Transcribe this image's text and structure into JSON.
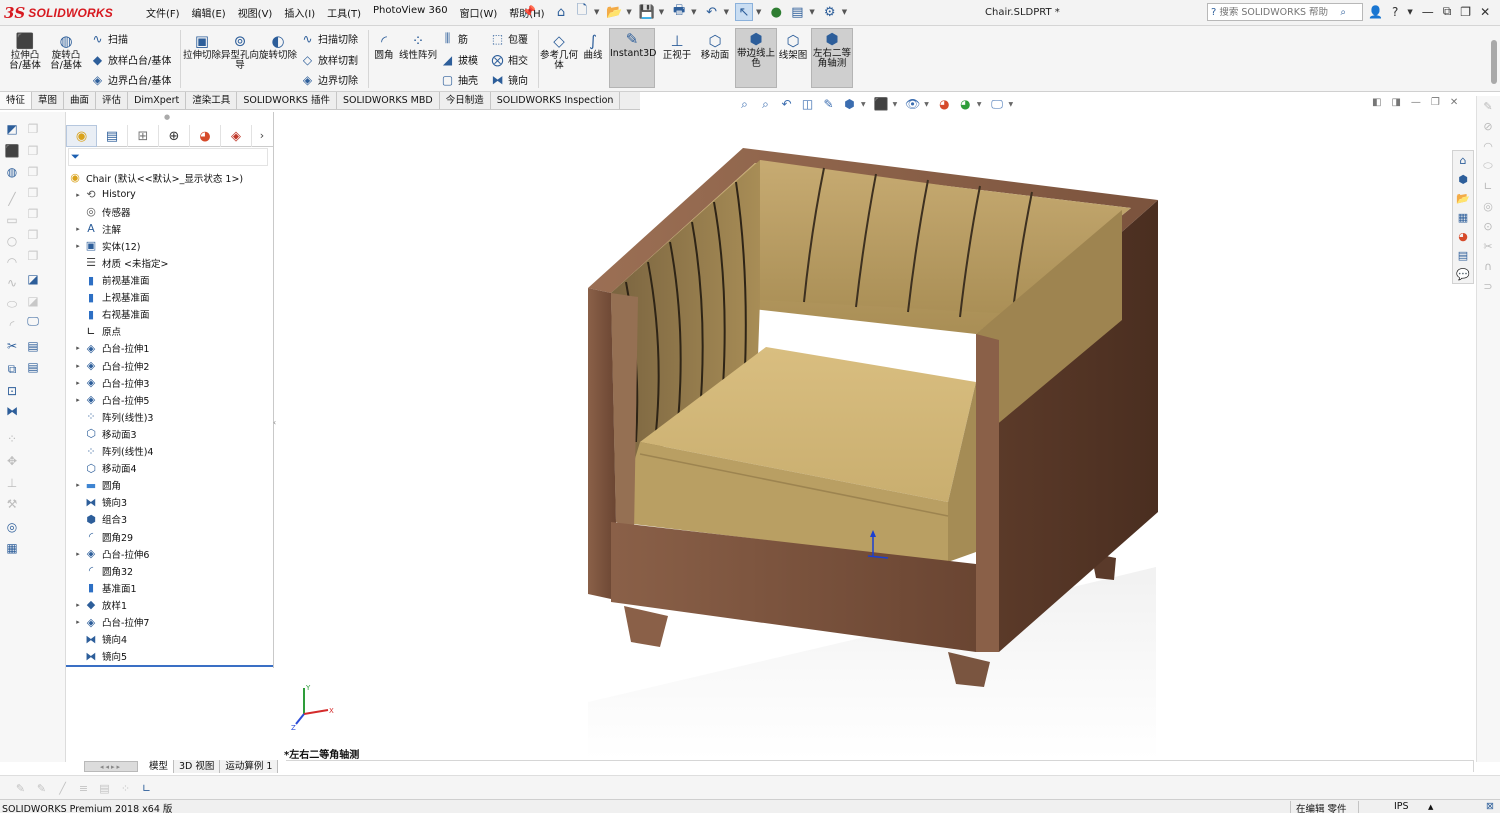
{
  "titlebar": {
    "logo_ds": "3S",
    "logo_text": "SOLIDWORKS",
    "menu": [
      "文件(F)",
      "编辑(E)",
      "视图(V)",
      "插入(I)",
      "工具(T)",
      "PhotoView 360",
      "窗口(W)",
      "帮助(H)"
    ],
    "document_title": "Chair.SLDPRT *",
    "search_placeholder": "搜索 SOLIDWORKS 帮助"
  },
  "command_manager": {
    "extrude_boss": "拉伸凸台/基体",
    "revolve_boss": "旋转凸台/基体",
    "sweep": "扫描",
    "loft": "放样凸台/基体",
    "boundary_boss": "边界凸台/基体",
    "extrude_cut": "拉伸切除",
    "hole_wizard": "异型孔向导",
    "revolve_cut": "旋转切除",
    "swept_cut": "扫描切除",
    "lofted_cut": "放样切割",
    "boundary_cut": "边界切除",
    "fillet": "圆角",
    "linear_pattern": "线性阵列",
    "rib": "筋",
    "draft": "拔模",
    "shell": "抽壳",
    "wrap": "包覆",
    "intersect": "相交",
    "mirror": "镜向",
    "ref_geometry": "参考几何体",
    "curves": "曲线",
    "instant3d": "Instant3D",
    "normal_to": "正视于",
    "move_face": "移动面",
    "shaded_edges": "带边线上色",
    "wireframe": "线架图",
    "iso_view": "左右二等角轴测"
  },
  "tabs": [
    "特征",
    "草图",
    "曲面",
    "评估",
    "DimXpert",
    "渲染工具",
    "SOLIDWORKS 插件",
    "SOLIDWORKS MBD",
    "今日制造",
    "SOLIDWORKS Inspection"
  ],
  "feature_tree": {
    "root": "Chair  (默认<<默认>_显示状态 1>)",
    "items": [
      {
        "label": "History",
        "icon": "history-icon",
        "expandable": true
      },
      {
        "label": "传感器",
        "icon": "sensor-icon",
        "expandable": false
      },
      {
        "label": "注解",
        "icon": "annotation-icon",
        "expandable": true
      },
      {
        "label": "实体(12)",
        "icon": "solid-bodies-icon",
        "expandable": true
      },
      {
        "label": "材质 <未指定>",
        "icon": "material-icon",
        "expandable": false
      },
      {
        "label": "前视基准面",
        "icon": "plane-icon",
        "expandable": false
      },
      {
        "label": "上视基准面",
        "icon": "plane-icon",
        "expandable": false
      },
      {
        "label": "右视基准面",
        "icon": "plane-icon",
        "expandable": false
      },
      {
        "label": "原点",
        "icon": "origin-icon",
        "expandable": false
      },
      {
        "label": "凸台-拉伸1",
        "icon": "extrude-icon",
        "expandable": true
      },
      {
        "label": "凸台-拉伸2",
        "icon": "extrude-icon",
        "expandable": true
      },
      {
        "label": "凸台-拉伸3",
        "icon": "extrude-icon",
        "expandable": true
      },
      {
        "label": "凸台-拉伸5",
        "icon": "extrude-icon",
        "expandable": true
      },
      {
        "label": "阵列(线性)3",
        "icon": "pattern-icon",
        "expandable": false
      },
      {
        "label": "移动面3",
        "icon": "move-face-icon",
        "expandable": false
      },
      {
        "label": "阵列(线性)4",
        "icon": "pattern-icon",
        "expandable": false
      },
      {
        "label": "移动面4",
        "icon": "move-face-icon",
        "expandable": false
      },
      {
        "label": "圆角",
        "icon": "folder-icon",
        "expandable": true
      },
      {
        "label": "镜向3",
        "icon": "mirror-icon",
        "expandable": false
      },
      {
        "label": "组合3",
        "icon": "combine-icon",
        "expandable": false
      },
      {
        "label": "圆角29",
        "icon": "fillet-icon",
        "expandable": false
      },
      {
        "label": "凸台-拉伸6",
        "icon": "extrude-icon",
        "expandable": true
      },
      {
        "label": "圆角32",
        "icon": "fillet-icon",
        "expandable": false
      },
      {
        "label": "基准面1",
        "icon": "plane-icon",
        "expandable": false
      },
      {
        "label": "放样1",
        "icon": "loft-icon",
        "expandable": true
      },
      {
        "label": "凸台-拉伸7",
        "icon": "extrude-icon",
        "expandable": true
      },
      {
        "label": "镜向4",
        "icon": "mirror-icon",
        "expandable": false
      },
      {
        "label": "镜向5",
        "icon": "mirror-icon",
        "expandable": false
      }
    ]
  },
  "viewport": {
    "view_name": "*左右二等角轴测",
    "triad": {
      "x": "X",
      "y": "Y",
      "z": "Z"
    }
  },
  "bottom_tabs": [
    "模型",
    "3D 视图",
    "运动算例 1"
  ],
  "status_bar": {
    "product": "SOLIDWORKS Premium 2018 x64 版",
    "mode": "在编辑 零件",
    "units": "IPS"
  },
  "colors": {
    "wood": "#6e4a36",
    "fabric": "#b69a5e",
    "seat": "#d4b97a",
    "accent_blue": "#2d5e9a",
    "logo_red": "#d71920"
  }
}
